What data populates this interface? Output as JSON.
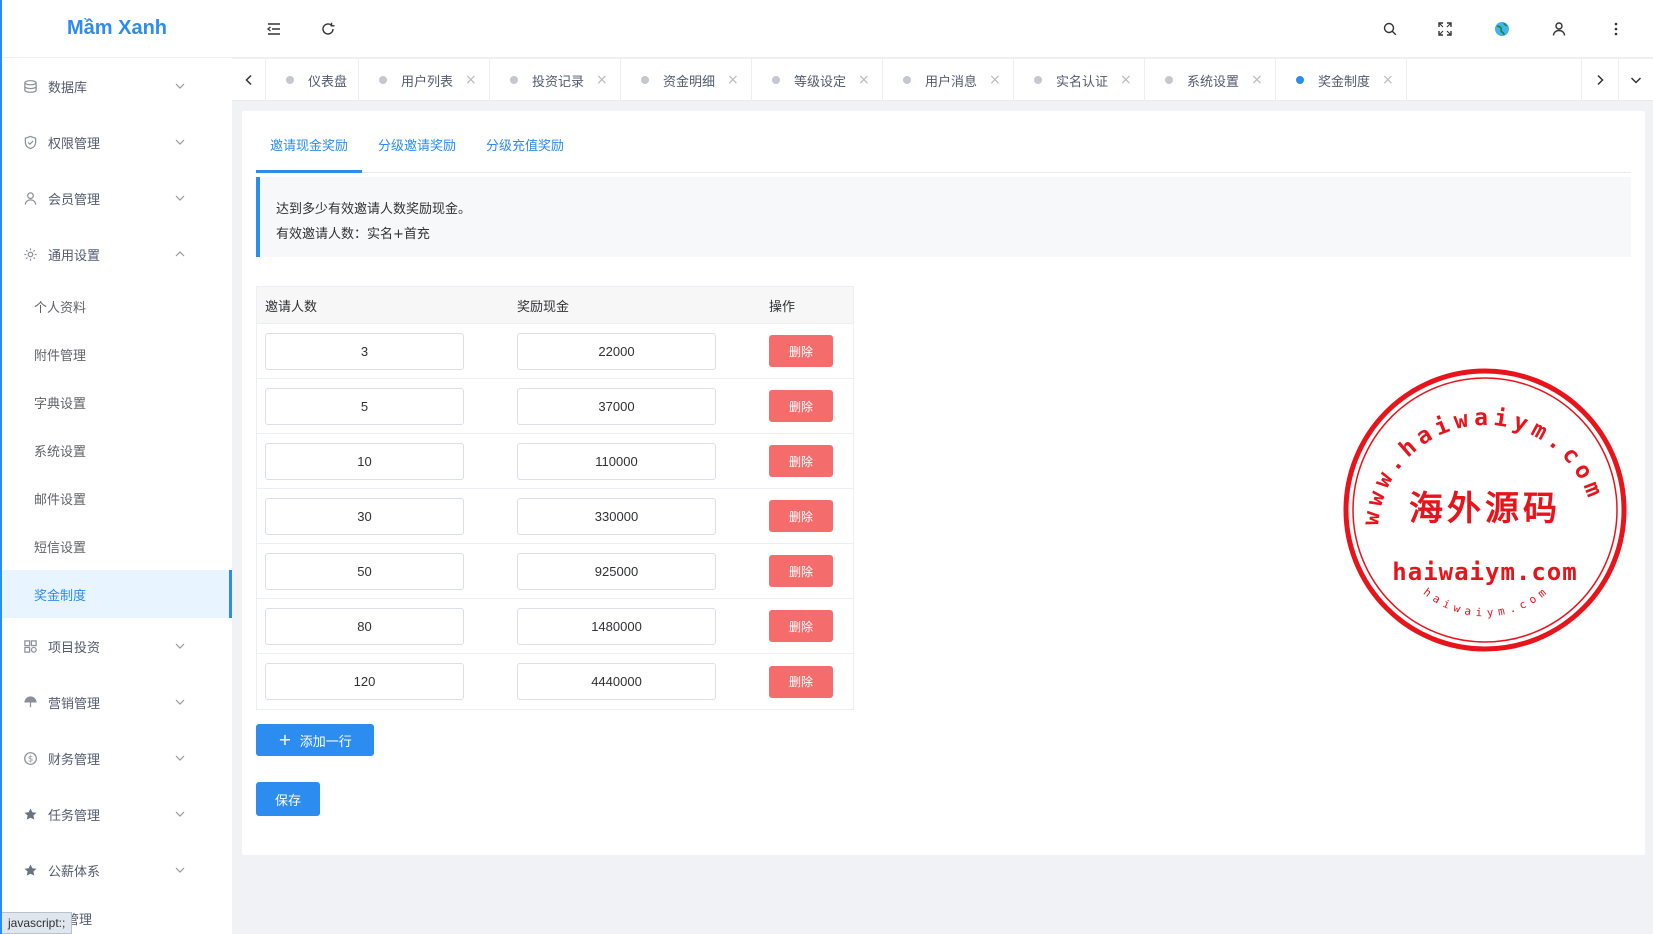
{
  "sidebar": {
    "logo": "Mầm Xanh",
    "menu_top": [
      {
        "label": "数据库",
        "icon": "database-icon"
      },
      {
        "label": "权限管理",
        "icon": "shield-icon"
      },
      {
        "label": "会员管理",
        "icon": "user-icon"
      },
      {
        "label": "通用设置",
        "icon": "gear-icon"
      }
    ],
    "submenu": [
      "个人资料",
      "附件管理",
      "字典设置",
      "系统设置",
      "邮件设置",
      "短信设置",
      "奖金制度"
    ],
    "active_submenu": "奖金制度",
    "menu_bottom": [
      {
        "label": "项目投资",
        "icon": "apps-icon"
      },
      {
        "label": "营销管理",
        "icon": "umbrella-icon"
      },
      {
        "label": "财务管理",
        "icon": "dollar-icon"
      },
      {
        "label": "任务管理",
        "icon": "star-icon"
      },
      {
        "label": "公薪体系",
        "icon": "star-icon"
      },
      {
        "label": "管理",
        "icon": "star-icon"
      }
    ],
    "status_text": "javascript:;"
  },
  "header": {
    "icons": [
      "menu-fold-icon",
      "refresh-icon",
      "search-icon",
      "fullscreen-icon",
      "globe-icon",
      "user-icon",
      "more-icon"
    ]
  },
  "tabs": {
    "items": [
      {
        "label": "仪表盘",
        "closable": false
      },
      {
        "label": "用户列表",
        "closable": true
      },
      {
        "label": "投资记录",
        "closable": true
      },
      {
        "label": "资金明细",
        "closable": true
      },
      {
        "label": "等级设定",
        "closable": true
      },
      {
        "label": "用户消息",
        "closable": true
      },
      {
        "label": "实名认证",
        "closable": true
      },
      {
        "label": "系统设置",
        "closable": true
      },
      {
        "label": "奖金制度",
        "closable": true
      }
    ],
    "active": "奖金制度",
    "close_glyph": "×"
  },
  "content": {
    "subtabs": [
      "邀请现金奖励",
      "分级邀请奖励",
      "分级充值奖励"
    ],
    "active_subtab": "邀请现金奖励",
    "notice": {
      "line1": "达到多少有效邀请人数奖励现金。",
      "line2": "有效邀请人数：实名+首充"
    },
    "table": {
      "headers": [
        "邀请人数",
        "奖励现金",
        "操作"
      ],
      "rows": [
        {
          "invites": "3",
          "cash": "22000"
        },
        {
          "invites": "5",
          "cash": "37000"
        },
        {
          "invites": "10",
          "cash": "110000"
        },
        {
          "invites": "30",
          "cash": "330000"
        },
        {
          "invites": "50",
          "cash": "925000"
        },
        {
          "invites": "80",
          "cash": "1480000"
        },
        {
          "invites": "120",
          "cash": "4440000"
        }
      ],
      "delete_label": "删除"
    },
    "add_row_label": "添加一行",
    "save_label": "保存"
  },
  "watermark": {
    "arc_top": "www.haiwaiym.com",
    "center": "海外源码",
    "domain": "haiwaiym.com",
    "arc_bottom": "haiwaiym.com"
  },
  "colors": {
    "primary": "#2d8cf0",
    "danger": "#f56c6c",
    "stamp": "#e8141b"
  }
}
